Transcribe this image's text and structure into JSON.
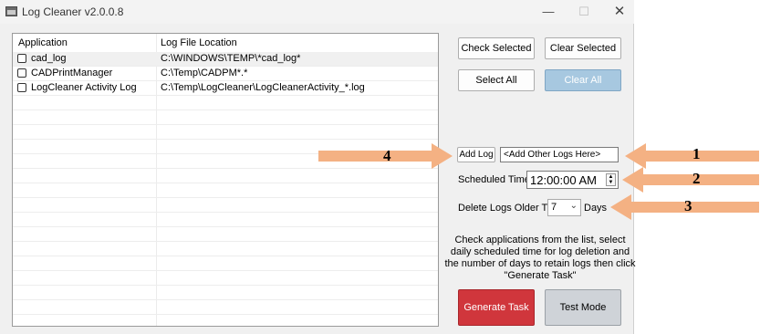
{
  "window": {
    "title": "Log Cleaner v2.0.0.8",
    "controls": [
      "—",
      "☐",
      "✕"
    ]
  },
  "list": {
    "columns": [
      "Application",
      "Log File Location"
    ],
    "rows": [
      {
        "app": "cad_log",
        "location": "C:\\WINDOWS\\TEMP\\*cad_log*"
      },
      {
        "app": "CADPrintManager",
        "location": "C:\\Temp\\CADPM*.*"
      },
      {
        "app": "LogCleaner Activity Log",
        "location": "C:\\Temp\\LogCleaner\\LogCleanerActivity_*.log"
      }
    ]
  },
  "buttons": {
    "check_selected": "Check Selected",
    "clear_selected": "Clear Selected",
    "select_all": "Select All",
    "clear_all": "Clear All",
    "add_log": "Add Log",
    "generate_task": "Generate Task",
    "test_mode": "Test Mode"
  },
  "add_log": {
    "value": "<Add Other Logs Here>"
  },
  "schedule": {
    "label": "Scheduled Time:",
    "value": "12:00:00 AM"
  },
  "retention": {
    "label": "Delete Logs Older Than",
    "value": "7",
    "unit": "Days"
  },
  "instructions": "Check applications from the list, select daily scheduled time for log deletion and the number of days to retain logs then click \"Generate Task\"",
  "callouts": [
    "1",
    "2",
    "3",
    "4"
  ],
  "colors": {
    "arrow": "#f4b183",
    "generate": "#d0363c",
    "clear_all": "#a7c8e0"
  }
}
